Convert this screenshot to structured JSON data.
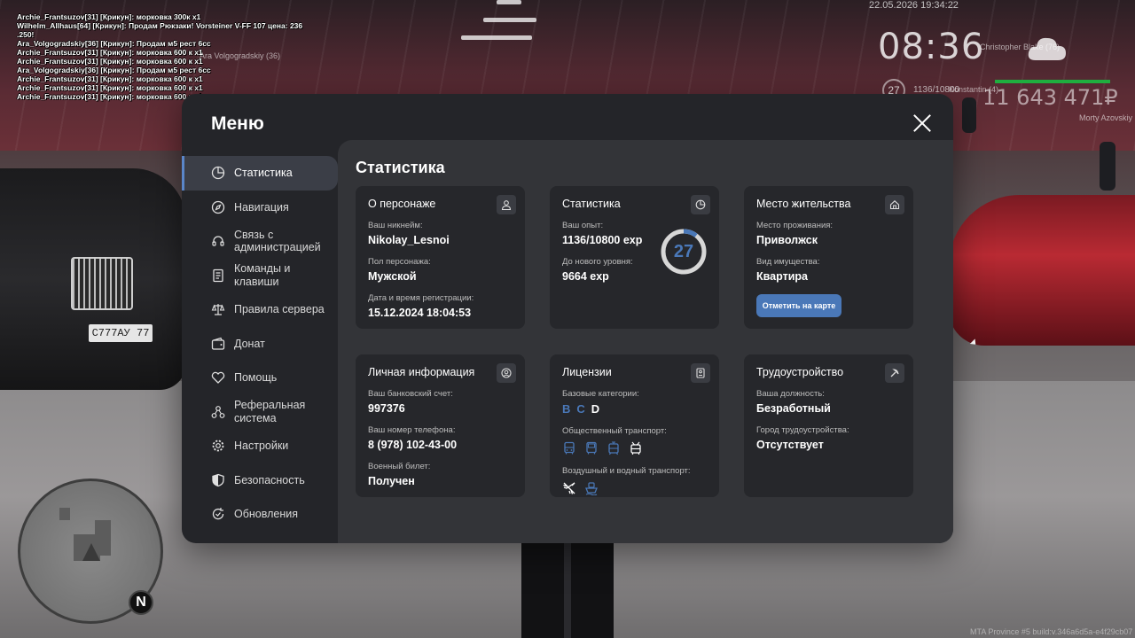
{
  "hud": {
    "datetime": "22.05.2026 19:34:22",
    "clock": "08:36",
    "level": "27",
    "exp": "1136/10800",
    "money": "11 643 471₽",
    "nametags": [
      "Christopher Blake (76)",
      "Ara Volgogradskiy (36)",
      "Konstantin (4)",
      "Morty Azovskiy"
    ],
    "watermark": "MTA Province #5 build:v.346a6d5a-e4f29cb07",
    "north": "N",
    "plate": "С777АУ 77"
  },
  "chat": [
    "Archie_Frantsuzov[31] [Крикун]: морковка 300к х1",
    "Wilhelm_Allhaus[64] [Крикун]: Продам Рюкзаки! Vorsteiner V-FF 107 цена: 236",
    ".250!",
    "Ara_Volgogradskiy[36] [Крикун]: Продам м5 рест 6сс",
    "Archie_Frantsuzov[31] [Крикун]: морковка 600 к х1",
    "Archie_Frantsuzov[31] [Крикун]: морковка 600 к х1",
    "Ara_Volgogradskiy[36] [Крикун]: Продам м5 рест 6сс",
    "Archie_Frantsuzov[31] [Крикун]: морковка 600 к х1",
    "Archie_Frantsuzov[31] [Крикун]: морковка 600 к х1",
    "Archie_Frantsuzov[31] [Крикун]: морковка 600 к х1"
  ],
  "menu": {
    "title": "Меню",
    "nav": [
      {
        "label": "Статистика",
        "icon": "pie-chart-icon"
      },
      {
        "label": "Навигация",
        "icon": "compass-icon"
      },
      {
        "label": "Связь с администрацией",
        "icon": "headset-icon"
      },
      {
        "label": "Команды и клавиши",
        "icon": "document-icon"
      },
      {
        "label": "Правила сервера",
        "icon": "scales-icon"
      },
      {
        "label": "Донат",
        "icon": "wallet-icon"
      },
      {
        "label": "Помощь",
        "icon": "heart-hand-icon"
      },
      {
        "label": "Реферальная система",
        "icon": "network-icon"
      },
      {
        "label": "Настройки",
        "icon": "gear-icon"
      },
      {
        "label": "Безопасность",
        "icon": "shield-icon"
      },
      {
        "label": "Обновления",
        "icon": "refresh-check-icon"
      }
    ],
    "active_index": 0
  },
  "content": {
    "title": "Статистика",
    "character": {
      "title": "О персонаже",
      "nick_label": "Ваш никнейм:",
      "nick": "Nikolay_Lesnoi",
      "gender_label": "Пол персонажа:",
      "gender": "Мужской",
      "reg_label": "Дата и время регистрации:",
      "reg": "15.12.2024 18:04:53"
    },
    "stats": {
      "title": "Статистика",
      "exp_label": "Ваш опыт:",
      "exp": "1136/10800 exp",
      "next_label": "До нового уровня:",
      "next": "9664 exp",
      "level": "27",
      "progress": 0.105
    },
    "residence": {
      "title": "Место жительства",
      "place_label": "Место проживания:",
      "place": "Приволжск",
      "type_label": "Вид имущества:",
      "type": "Квартира",
      "button": "Отметить на карте"
    },
    "personal": {
      "title": "Личная информация",
      "bank_label": "Ваш банковский счет:",
      "bank": "997376",
      "phone_label": "Ваш номер телефона:",
      "phone": "8 (978) 102-43-00",
      "military_label": "Военный билет:",
      "military": "Получен"
    },
    "licenses": {
      "title": "Лицензии",
      "base_label": "Базовые категории:",
      "base": [
        {
          "cat": "B",
          "active": true
        },
        {
          "cat": "C",
          "active": true
        },
        {
          "cat": "D",
          "active": false
        }
      ],
      "public_label": "Общественный транспорт:",
      "public_icons": [
        "bus-icon",
        "bus-icon",
        "tram-icon",
        "trolleybus-icon"
      ],
      "air_label": "Воздушный и водный транспорт:",
      "air_icons": [
        "plane-icon",
        "boat-icon"
      ]
    },
    "employment": {
      "title": "Трудоустройство",
      "job_label": "Ваша должность:",
      "job": "Безработный",
      "city_label": "Город трудоустройства:",
      "city": "Отсутствует"
    }
  },
  "colors": {
    "accent": "#4a78b8",
    "panel": "#242529",
    "content": "#333438",
    "card": "#26272b"
  }
}
